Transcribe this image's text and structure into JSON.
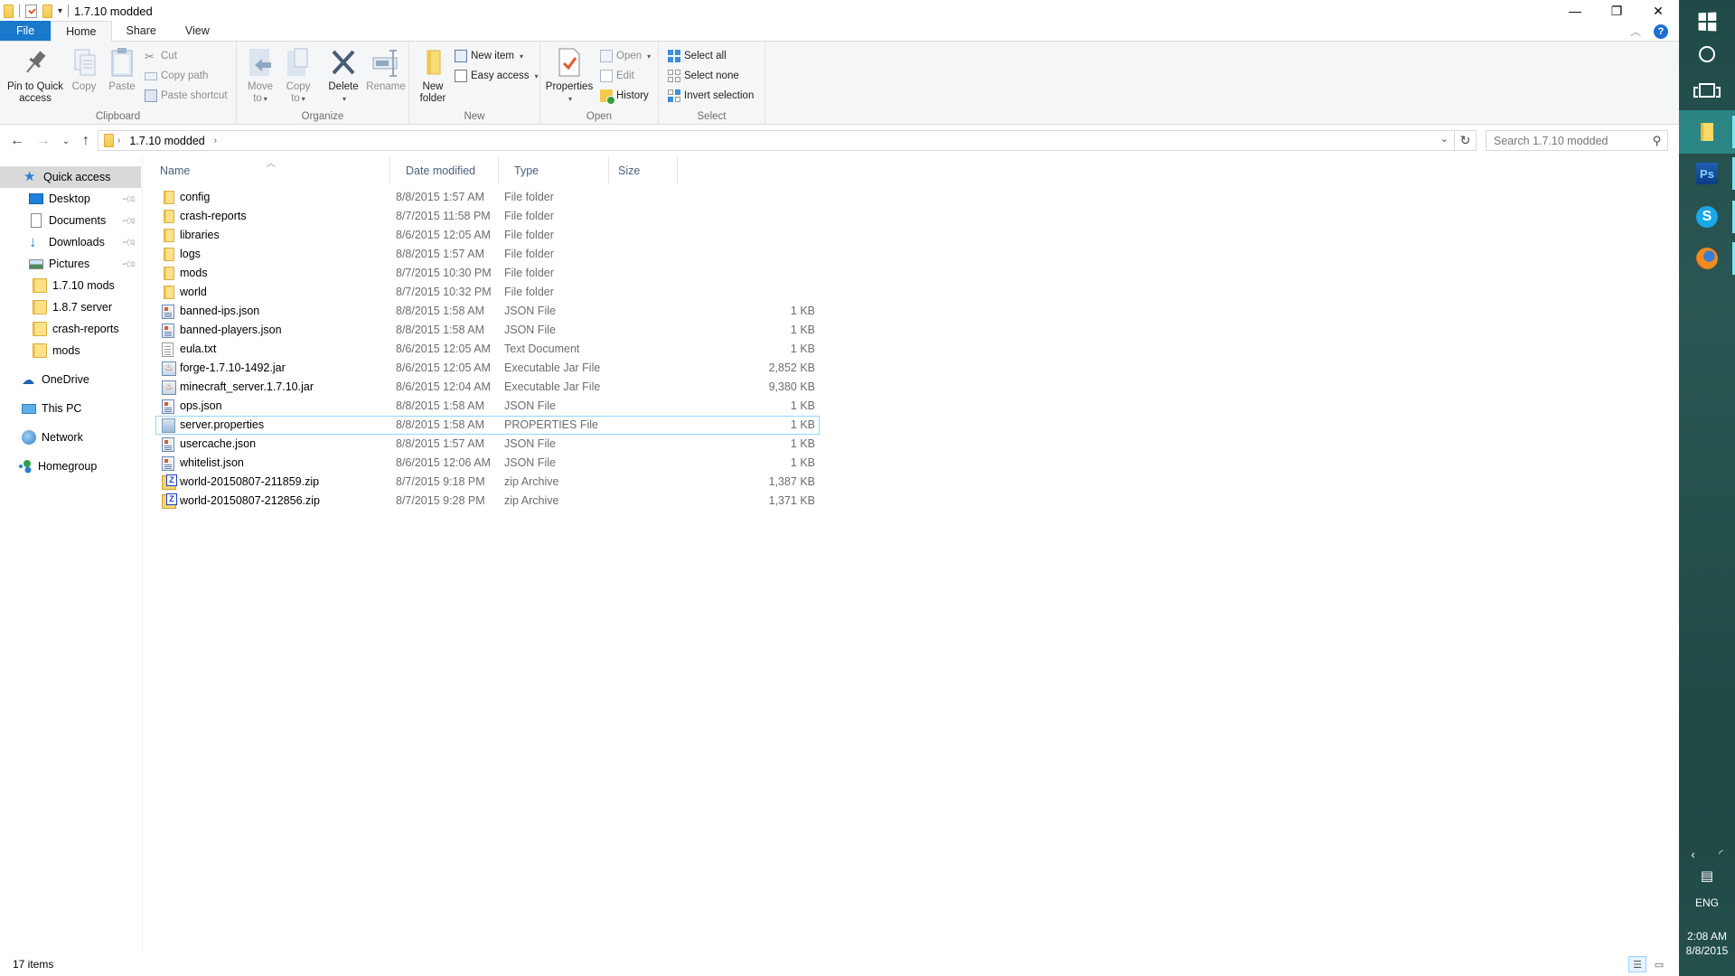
{
  "window": {
    "title": "1.7.10 modded",
    "controls": {
      "minimize": "—",
      "restore": "❐",
      "close": "✕"
    }
  },
  "ribbon": {
    "tabs": [
      {
        "label": "File"
      },
      {
        "label": "Home"
      },
      {
        "label": "Share"
      },
      {
        "label": "View"
      }
    ],
    "active_tab": "Home",
    "groups": {
      "clipboard": {
        "label": "Clipboard",
        "pin": "Pin to Quick access",
        "pin_line1": "Pin to Quick",
        "pin_line2": "access",
        "copy": "Copy",
        "paste": "Paste",
        "cut": "Cut",
        "copy_path": "Copy path",
        "paste_shortcut": "Paste shortcut"
      },
      "organize": {
        "label": "Organize",
        "move_to_1": "Move",
        "move_to_2": "to",
        "copy_to_1": "Copy",
        "copy_to_2": "to",
        "delete": "Delete",
        "rename": "Rename"
      },
      "new": {
        "label": "New",
        "new_folder_1": "New",
        "new_folder_2": "folder",
        "new_item": "New item",
        "easy_access": "Easy access"
      },
      "open": {
        "label": "Open",
        "properties": "Properties",
        "open": "Open",
        "edit": "Edit",
        "history": "History"
      },
      "select": {
        "label": "Select",
        "select_all": "Select all",
        "select_none": "Select none",
        "invert_selection": "Invert selection"
      }
    }
  },
  "address_bar": {
    "breadcrumb": [
      "1.7.10 modded"
    ],
    "search_placeholder": "Search 1.7.10 modded"
  },
  "nav_pane": {
    "quick_access": "Quick access",
    "pinned": [
      {
        "label": "Desktop",
        "icon": "desktop-icon",
        "pinned": true
      },
      {
        "label": "Documents",
        "icon": "documents-icon",
        "pinned": true
      },
      {
        "label": "Downloads",
        "icon": "downloads-icon",
        "pinned": true
      },
      {
        "label": "Pictures",
        "icon": "pictures-icon",
        "pinned": true
      },
      {
        "label": "1.7.10 mods",
        "icon": "folder-icon",
        "pinned": false
      },
      {
        "label": "1.8.7 server",
        "icon": "folder-icon",
        "pinned": false
      },
      {
        "label": "crash-reports",
        "icon": "folder-icon",
        "pinned": false
      },
      {
        "label": "mods",
        "icon": "folder-icon",
        "pinned": false
      }
    ],
    "roots": [
      {
        "label": "OneDrive",
        "icon": "onedrive-icon"
      },
      {
        "label": "This PC",
        "icon": "this-pc-icon"
      },
      {
        "label": "Network",
        "icon": "network-icon"
      },
      {
        "label": "Homegroup",
        "icon": "homegroup-icon"
      }
    ]
  },
  "file_list": {
    "columns": [
      "Name",
      "Date modified",
      "Type",
      "Size"
    ],
    "sort_column": "Name",
    "focused_item": "server.properties",
    "items": [
      {
        "name": "config",
        "date": "8/8/2015 1:57 AM",
        "type": "File folder",
        "size": "",
        "icon": "folder"
      },
      {
        "name": "crash-reports",
        "date": "8/7/2015 11:58 PM",
        "type": "File folder",
        "size": "",
        "icon": "folder"
      },
      {
        "name": "libraries",
        "date": "8/6/2015 12:05 AM",
        "type": "File folder",
        "size": "",
        "icon": "folder"
      },
      {
        "name": "logs",
        "date": "8/8/2015 1:57 AM",
        "type": "File folder",
        "size": "",
        "icon": "folder"
      },
      {
        "name": "mods",
        "date": "8/7/2015 10:30 PM",
        "type": "File folder",
        "size": "",
        "icon": "folder"
      },
      {
        "name": "world",
        "date": "8/7/2015 10:32 PM",
        "type": "File folder",
        "size": "",
        "icon": "folder"
      },
      {
        "name": "banned-ips.json",
        "date": "8/8/2015 1:58 AM",
        "type": "JSON File",
        "size": "1 KB",
        "icon": "json"
      },
      {
        "name": "banned-players.json",
        "date": "8/8/2015 1:58 AM",
        "type": "JSON File",
        "size": "1 KB",
        "icon": "json"
      },
      {
        "name": "eula.txt",
        "date": "8/6/2015 12:05 AM",
        "type": "Text Document",
        "size": "1 KB",
        "icon": "txt"
      },
      {
        "name": "forge-1.7.10-1492.jar",
        "date": "8/6/2015 12:05 AM",
        "type": "Executable Jar File",
        "size": "2,852 KB",
        "icon": "jar"
      },
      {
        "name": "minecraft_server.1.7.10.jar",
        "date": "8/6/2015 12:04 AM",
        "type": "Executable Jar File",
        "size": "9,380 KB",
        "icon": "jar"
      },
      {
        "name": "ops.json",
        "date": "8/8/2015 1:58 AM",
        "type": "JSON File",
        "size": "1 KB",
        "icon": "json"
      },
      {
        "name": "server.properties",
        "date": "8/8/2015 1:58 AM",
        "type": "PROPERTIES File",
        "size": "1 KB",
        "icon": "properties"
      },
      {
        "name": "usercache.json",
        "date": "8/8/2015 1:57 AM",
        "type": "JSON File",
        "size": "1 KB",
        "icon": "json"
      },
      {
        "name": "whitelist.json",
        "date": "8/6/2015 12:06 AM",
        "type": "JSON File",
        "size": "1 KB",
        "icon": "json"
      },
      {
        "name": "world-20150807-211859.zip",
        "date": "8/7/2015 9:18 PM",
        "type": "zip Archive",
        "size": "1,387 KB",
        "icon": "zip"
      },
      {
        "name": "world-20150807-212856.zip",
        "date": "8/7/2015 9:28 PM",
        "type": "zip Archive",
        "size": "1,371 KB",
        "icon": "zip"
      }
    ]
  },
  "status_bar": {
    "item_count": "17 items"
  },
  "taskbar": {
    "apps": [
      {
        "name": "File Explorer",
        "active": true
      },
      {
        "name": "Photoshop",
        "label": "Ps",
        "active": false
      },
      {
        "name": "Skype",
        "label": "S",
        "active": false
      },
      {
        "name": "Firefox",
        "active": false
      }
    ],
    "language": "ENG",
    "time": "2:08 AM",
    "date": "8/8/2015"
  },
  "colors": {
    "file_tab": "#1979ca",
    "ribbon_bg": "#f5f6f7",
    "header_text": "#4c607a",
    "focus_border": "#99d1ff",
    "nav_selected": "#d9d9d9",
    "taskbar": "#24504c"
  }
}
